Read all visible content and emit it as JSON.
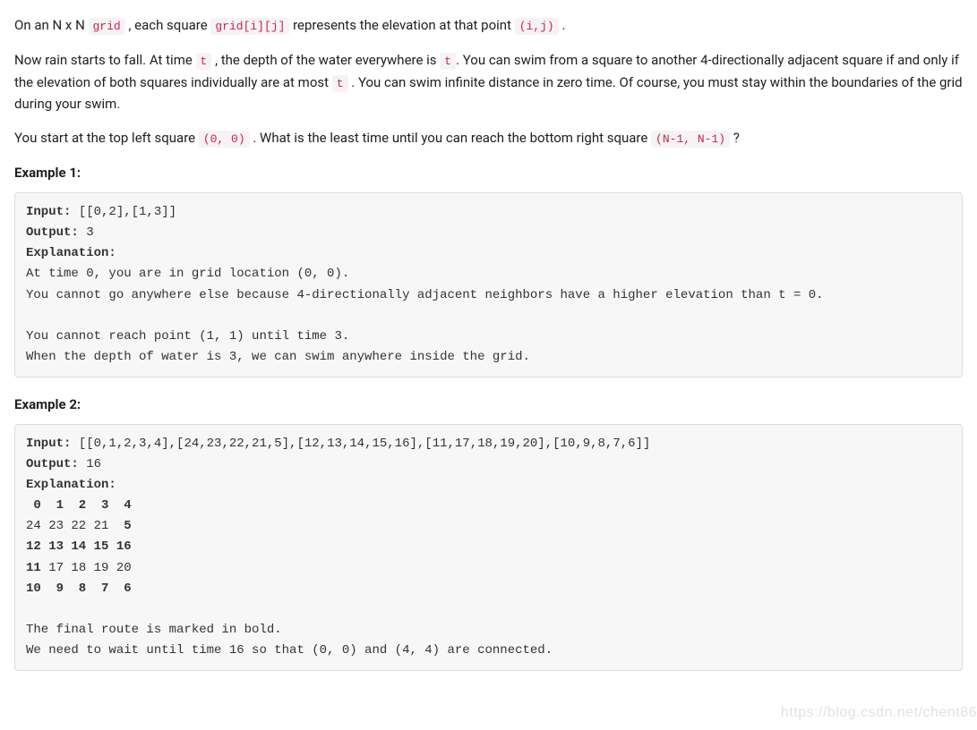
{
  "p1": {
    "t1": "On an N x N ",
    "c1": "grid",
    "t2": " , each square ",
    "c2": "grid[i][j]",
    "t3": " represents the elevation at that point ",
    "c3": "(i,j)",
    "t4": " ."
  },
  "p2": {
    "t1": "Now rain starts to fall. At time ",
    "c1": "t",
    "t2": " , the depth of the water everywhere is ",
    "c2": "t",
    "t3": ". You can swim from a square to another 4-directionally adjacent square if and only if the elevation of both squares individually are at most ",
    "c3": "t",
    "t4": " . You can swim infinite distance in zero time. Of course, you must stay within the boundaries of the grid during your swim."
  },
  "p3": {
    "t1": "You start at the top left square ",
    "c1": "(0, 0)",
    "t2": " . What is the least time until you can reach the bottom right square ",
    "c2": "(N-1, N-1)",
    "t3": " ?"
  },
  "ex1": {
    "heading": "Example 1:",
    "labels": {
      "input": "Input:",
      "output": "Output:",
      "explanation": "Explanation:"
    },
    "input_val": " [[0,2],[1,3]]",
    "output_val": " 3",
    "body": "At time 0, you are in grid location (0, 0).\nYou cannot go anywhere else because 4-directionally adjacent neighbors have a higher elevation than t = 0.\n\nYou cannot reach point (1, 1) until time 3.\nWhen the depth of water is 3, we can swim anywhere inside the grid."
  },
  "ex2": {
    "heading": "Example 2:",
    "labels": {
      "input": "Input:",
      "output": "Output:",
      "explanation": "Explanation:"
    },
    "input_val": " [[0,1,2,3,4],[24,23,22,21,5],[12,13,14,15,16],[11,17,18,19,20],[10,9,8,7,6]]",
    "output_val": " 16",
    "grid": {
      "r0": " 0  1  2  3  4",
      "r1_a": "24 23 22 21  ",
      "r1_b": "5",
      "r2": "12 13 14 15 16",
      "r3_a": "11",
      "r3_b": " 17 18 19 20",
      "r4": "10  9  8  7  6"
    },
    "tail": "\nThe final route is marked in bold.\nWe need to wait until time 16 so that (0, 0) and (4, 4) are connected."
  },
  "watermark": "https://blog.csdn.net/chent86"
}
